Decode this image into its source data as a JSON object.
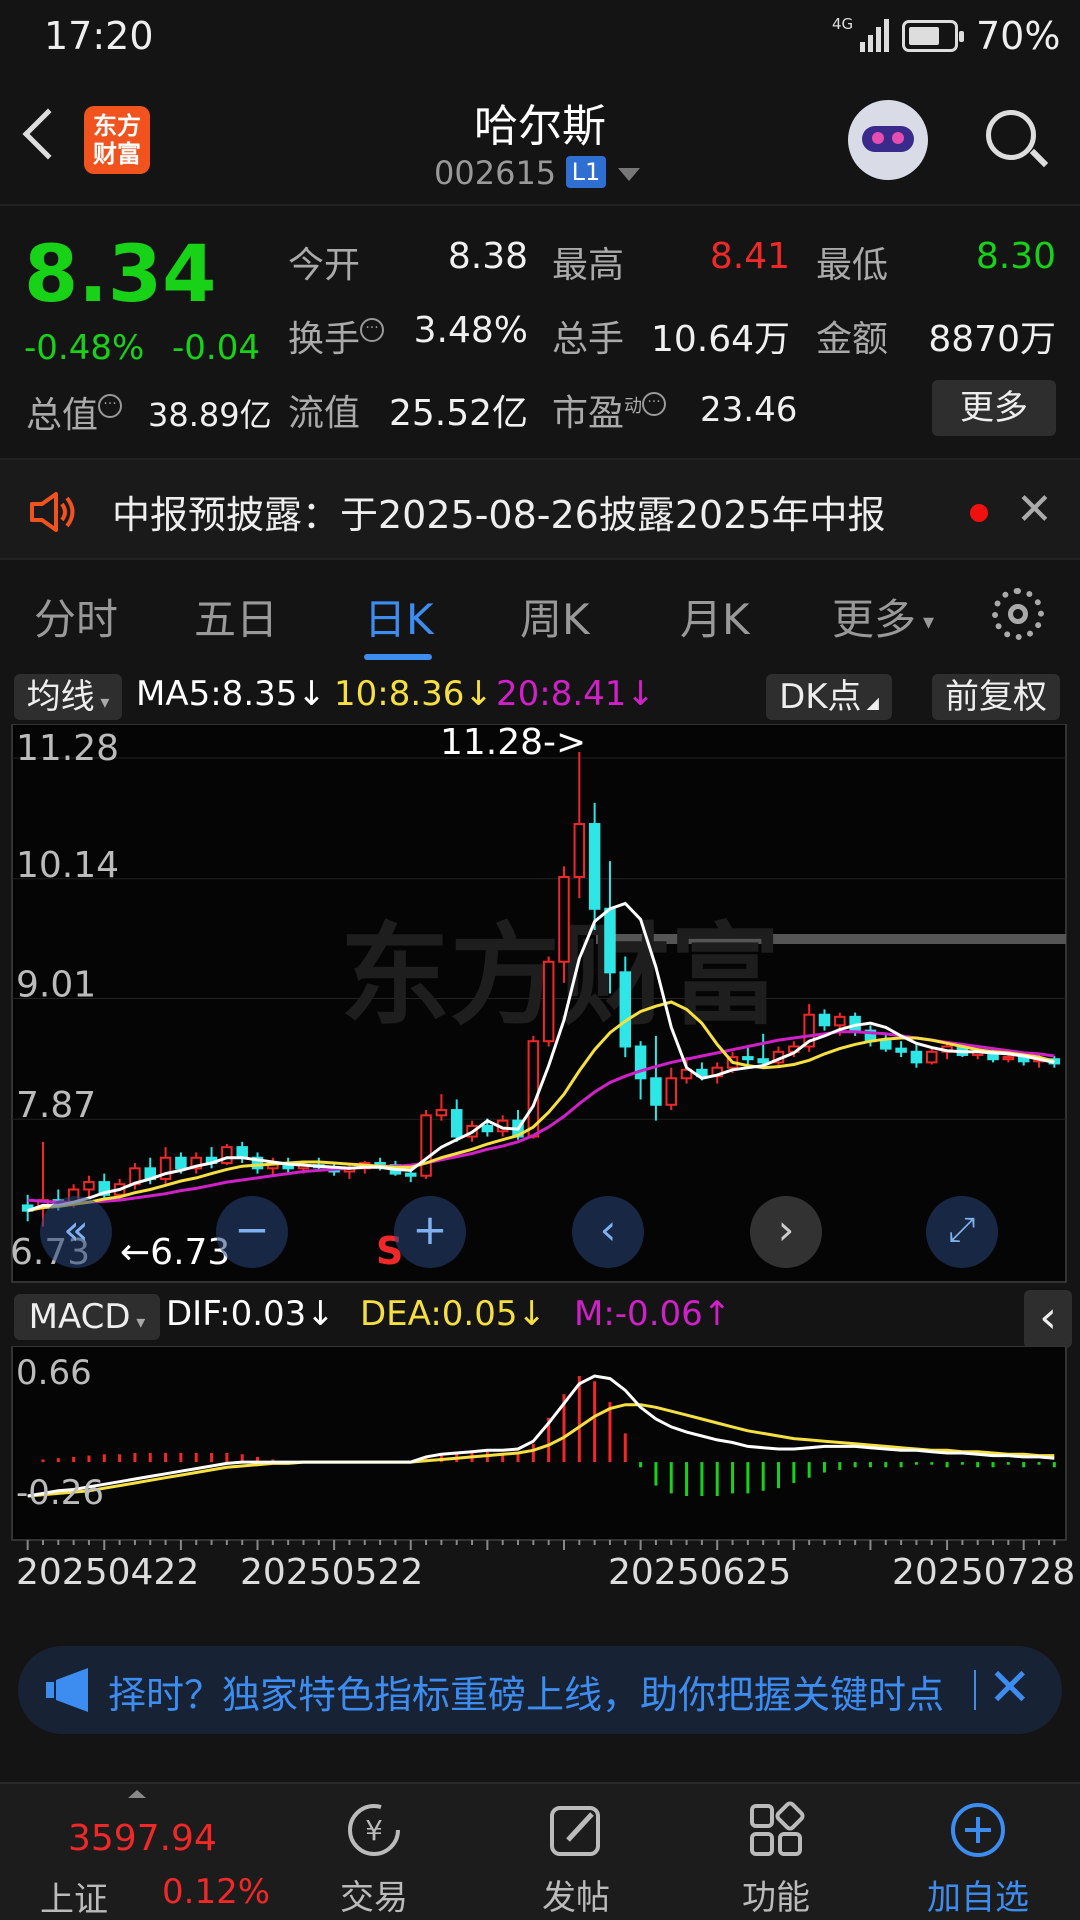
{
  "status_bar": {
    "time": "17:20",
    "network": "4G",
    "battery": "70%"
  },
  "header": {
    "title": "哈尔斯",
    "code": "002615",
    "level": "L1",
    "logo_line1": "东方",
    "logo_line2": "财富"
  },
  "quote": {
    "price": "8.34",
    "change_pct": "-0.48%",
    "change": "-0.04",
    "open_label": "今开",
    "open": "8.38",
    "high_label": "最高",
    "high": "8.41",
    "low_label": "最低",
    "low": "8.30",
    "turnover_label": "换手",
    "turnover": "3.48%",
    "volume_label": "总手",
    "volume": "10.64万",
    "amount_label": "金额",
    "amount": "8870万",
    "mcap_label": "总值",
    "mcap": "38.89亿",
    "float_label": "流值",
    "float": "25.52亿",
    "pe_label": "市盈",
    "pe_sup": "动",
    "pe": "23.46",
    "more_label": "更多"
  },
  "notice": {
    "text": "中报预披露：于2025-08-26披露2025年中报"
  },
  "tabs": [
    "分时",
    "五日",
    "日K",
    "周K",
    "月K",
    "更多"
  ],
  "active_tab": "日K",
  "ma_bar": {
    "select": "均线",
    "ma5": "MA5:8.35↓",
    "ma10": "10:8.36↓",
    "ma20": "20:8.41↓",
    "dk": "DK点",
    "adjust": "前复权"
  },
  "colors": {
    "up": "#f02828",
    "down": "#17d217",
    "candle_down": "#2ee6e6",
    "ma5": "#ffffff",
    "ma10": "#f5e040",
    "ma20": "#d020c8",
    "accent": "#3d8cf0"
  },
  "kline_labels": {
    "max_marker": "11.28->",
    "min_marker": "6.73",
    "min_marker_arrow": "←6.73",
    "signal": "S",
    "watermark": "东方财富"
  },
  "macd_bar": {
    "select": "MACD",
    "dif": "DIF:0.03↓",
    "dea": "DEA:0.05↓",
    "m": "M:-0.06↑"
  },
  "chart_data": [
    {
      "type": "candlestick",
      "yticks": [
        "11.28",
        "10.14",
        "9.01",
        "7.87"
      ],
      "ylim": [
        6.73,
        11.28
      ],
      "max": 11.28,
      "min": 6.73,
      "ohlc": [
        [
          7.0,
          7.1,
          6.85,
          6.95
        ],
        [
          6.98,
          7.6,
          6.8,
          7.05
        ],
        [
          7.05,
          7.15,
          6.95,
          7.0
        ],
        [
          7.02,
          7.2,
          6.98,
          7.15
        ],
        [
          7.15,
          7.28,
          7.08,
          7.22
        ],
        [
          7.22,
          7.3,
          7.05,
          7.1
        ],
        [
          7.1,
          7.25,
          7.05,
          7.2
        ],
        [
          7.2,
          7.4,
          7.15,
          7.35
        ],
        [
          7.35,
          7.45,
          7.2,
          7.25
        ],
        [
          7.25,
          7.55,
          7.2,
          7.45
        ],
        [
          7.45,
          7.5,
          7.3,
          7.35
        ],
        [
          7.35,
          7.5,
          7.3,
          7.45
        ],
        [
          7.45,
          7.55,
          7.35,
          7.4
        ],
        [
          7.4,
          7.58,
          7.38,
          7.55
        ],
        [
          7.55,
          7.6,
          7.4,
          7.45
        ],
        [
          7.45,
          7.5,
          7.3,
          7.35
        ],
        [
          7.35,
          7.45,
          7.28,
          7.4
        ],
        [
          7.4,
          7.45,
          7.3,
          7.35
        ],
        [
          7.35,
          7.42,
          7.3,
          7.38
        ],
        [
          7.38,
          7.45,
          7.32,
          7.36
        ],
        [
          7.36,
          7.4,
          7.28,
          7.32
        ],
        [
          7.32,
          7.38,
          7.25,
          7.35
        ],
        [
          7.35,
          7.42,
          7.3,
          7.4
        ],
        [
          7.4,
          7.45,
          7.33,
          7.38
        ],
        [
          7.38,
          7.42,
          7.28,
          7.3
        ],
        [
          7.3,
          7.36,
          7.22,
          7.28
        ],
        [
          7.28,
          7.9,
          7.25,
          7.85
        ],
        [
          7.85,
          8.05,
          7.8,
          7.9
        ],
        [
          7.9,
          8.0,
          7.6,
          7.65
        ],
        [
          7.65,
          7.8,
          7.6,
          7.75
        ],
        [
          7.75,
          7.82,
          7.65,
          7.7
        ],
        [
          7.7,
          7.85,
          7.65,
          7.8
        ],
        [
          7.8,
          7.9,
          7.62,
          7.65
        ],
        [
          7.65,
          8.6,
          7.63,
          8.55
        ],
        [
          8.55,
          9.35,
          8.5,
          9.3
        ],
        [
          9.3,
          10.2,
          9.1,
          10.1
        ],
        [
          10.1,
          11.28,
          9.9,
          10.6
        ],
        [
          10.6,
          10.8,
          9.6,
          9.8
        ],
        [
          9.8,
          10.25,
          9.0,
          9.2
        ],
        [
          9.2,
          9.35,
          8.4,
          8.5
        ],
        [
          8.5,
          8.55,
          8.0,
          8.2
        ],
        [
          8.2,
          8.6,
          7.8,
          7.95
        ],
        [
          7.95,
          8.3,
          7.9,
          8.2
        ],
        [
          8.2,
          8.4,
          8.15,
          8.28
        ],
        [
          8.28,
          8.35,
          8.18,
          8.22
        ],
        [
          8.22,
          8.35,
          8.15,
          8.3
        ],
        [
          8.3,
          8.45,
          8.25,
          8.4
        ],
        [
          8.4,
          8.5,
          8.32,
          8.38
        ],
        [
          8.38,
          8.62,
          8.3,
          8.35
        ],
        [
          8.35,
          8.5,
          8.3,
          8.45
        ],
        [
          8.45,
          8.55,
          8.4,
          8.5
        ],
        [
          8.5,
          8.9,
          8.45,
          8.8
        ],
        [
          8.8,
          8.85,
          8.65,
          8.7
        ],
        [
          8.7,
          8.82,
          8.6,
          8.78
        ],
        [
          8.78,
          8.82,
          8.6,
          8.65
        ],
        [
          8.65,
          8.7,
          8.5,
          8.55
        ],
        [
          8.55,
          8.62,
          8.45,
          8.48
        ],
        [
          8.48,
          8.55,
          8.4,
          8.45
        ],
        [
          8.45,
          8.52,
          8.3,
          8.35
        ],
        [
          8.35,
          8.5,
          8.33,
          8.45
        ],
        [
          8.45,
          8.55,
          8.38,
          8.5
        ],
        [
          8.5,
          8.52,
          8.4,
          8.42
        ],
        [
          8.42,
          8.5,
          8.38,
          8.45
        ],
        [
          8.45,
          8.48,
          8.35,
          8.38
        ],
        [
          8.38,
          8.45,
          8.35,
          8.4
        ],
        [
          8.4,
          8.45,
          8.32,
          8.36
        ],
        [
          8.36,
          8.42,
          8.3,
          8.38
        ],
        [
          8.38,
          8.41,
          8.3,
          8.34
        ]
      ],
      "ma5": [
        6.95,
        7.0,
        7.0,
        7.03,
        7.07,
        7.12,
        7.15,
        7.21,
        7.25,
        7.3,
        7.33,
        7.37,
        7.4,
        7.45,
        7.45,
        7.43,
        7.41,
        7.39,
        7.38,
        7.37,
        7.36,
        7.35,
        7.36,
        7.36,
        7.34,
        7.33,
        7.44,
        7.55,
        7.62,
        7.69,
        7.8,
        7.73,
        7.72,
        7.94,
        8.32,
        8.75,
        9.33,
        9.68,
        9.8,
        9.85,
        9.7,
        9.25,
        8.68,
        8.3,
        8.2,
        8.23,
        8.28,
        8.3,
        8.32,
        8.38,
        8.44,
        8.55,
        8.6,
        8.66,
        8.7,
        8.72,
        8.68,
        8.6,
        8.53,
        8.49,
        8.46,
        8.45,
        8.45,
        8.44,
        8.43,
        8.41,
        8.38,
        8.35
      ],
      "ma10": [
        6.95,
        6.98,
        6.99,
        7.01,
        7.03,
        7.06,
        7.08,
        7.12,
        7.15,
        7.19,
        7.23,
        7.26,
        7.3,
        7.34,
        7.37,
        7.38,
        7.39,
        7.4,
        7.41,
        7.41,
        7.4,
        7.39,
        7.38,
        7.37,
        7.36,
        7.36,
        7.4,
        7.45,
        7.49,
        7.53,
        7.58,
        7.62,
        7.66,
        7.74,
        7.88,
        8.05,
        8.27,
        8.47,
        8.63,
        8.74,
        8.83,
        8.88,
        8.92,
        8.85,
        8.72,
        8.52,
        8.35,
        8.32,
        8.3,
        8.31,
        8.33,
        8.37,
        8.43,
        8.48,
        8.52,
        8.55,
        8.57,
        8.58,
        8.58,
        8.56,
        8.53,
        8.5,
        8.47,
        8.45,
        8.44,
        8.42,
        8.4,
        8.36
      ],
      "ma20": [
        7.05,
        7.04,
        7.03,
        7.03,
        7.03,
        7.04,
        7.05,
        7.07,
        7.09,
        7.11,
        7.14,
        7.16,
        7.19,
        7.22,
        7.24,
        7.26,
        7.28,
        7.3,
        7.32,
        7.33,
        7.34,
        7.35,
        7.36,
        7.37,
        7.37,
        7.38,
        7.4,
        7.43,
        7.46,
        7.49,
        7.53,
        7.56,
        7.6,
        7.66,
        7.74,
        7.84,
        7.96,
        8.07,
        8.16,
        8.22,
        8.27,
        8.31,
        8.35,
        8.38,
        8.41,
        8.44,
        8.47,
        8.5,
        8.53,
        8.56,
        8.58,
        8.6,
        8.62,
        8.64,
        8.64,
        8.63,
        8.62,
        8.6,
        8.58,
        8.56,
        8.54,
        8.52,
        8.5,
        8.48,
        8.46,
        8.44,
        8.43,
        8.41
      ]
    },
    {
      "type": "macd",
      "yticks": [
        "0.66",
        "-0.26"
      ],
      "ylim": [
        -0.26,
        0.66
      ],
      "dif": [
        -0.26,
        -0.24,
        -0.22,
        -0.21,
        -0.19,
        -0.17,
        -0.15,
        -0.13,
        -0.11,
        -0.09,
        -0.07,
        -0.05,
        -0.03,
        -0.01,
        0.0,
        0.0,
        0.0,
        0.0,
        0.0,
        0.0,
        0.0,
        0.0,
        0.0,
        0.0,
        0.0,
        0.0,
        0.04,
        0.06,
        0.07,
        0.08,
        0.09,
        0.09,
        0.1,
        0.16,
        0.3,
        0.45,
        0.6,
        0.66,
        0.64,
        0.55,
        0.42,
        0.33,
        0.27,
        0.23,
        0.2,
        0.17,
        0.15,
        0.12,
        0.11,
        0.1,
        0.1,
        0.11,
        0.12,
        0.12,
        0.12,
        0.11,
        0.1,
        0.09,
        0.09,
        0.08,
        0.07,
        0.07,
        0.06,
        0.05,
        0.05,
        0.04,
        0.04,
        0.03
      ],
      "dea": [
        -0.26,
        -0.25,
        -0.24,
        -0.23,
        -0.22,
        -0.2,
        -0.18,
        -0.16,
        -0.14,
        -0.12,
        -0.1,
        -0.08,
        -0.06,
        -0.04,
        -0.03,
        -0.02,
        -0.01,
        -0.01,
        0.0,
        0.0,
        0.0,
        0.0,
        0.0,
        0.0,
        0.0,
        0.0,
        0.01,
        0.02,
        0.03,
        0.04,
        0.05,
        0.06,
        0.07,
        0.09,
        0.13,
        0.19,
        0.27,
        0.35,
        0.41,
        0.44,
        0.44,
        0.42,
        0.39,
        0.36,
        0.33,
        0.3,
        0.27,
        0.24,
        0.22,
        0.2,
        0.18,
        0.17,
        0.16,
        0.15,
        0.14,
        0.13,
        0.12,
        0.11,
        0.1,
        0.09,
        0.09,
        0.08,
        0.08,
        0.07,
        0.06,
        0.06,
        0.05,
        0.05
      ],
      "m": [
        0.0,
        0.02,
        0.03,
        0.04,
        0.05,
        0.06,
        0.06,
        0.07,
        0.07,
        0.07,
        0.07,
        0.07,
        0.07,
        0.07,
        0.06,
        0.04,
        0.02,
        0.01,
        0.0,
        0.0,
        0.0,
        0.0,
        0.0,
        0.0,
        0.0,
        0.0,
        0.04,
        0.06,
        0.08,
        0.08,
        0.08,
        0.07,
        0.06,
        0.14,
        0.34,
        0.52,
        0.66,
        0.62,
        0.46,
        0.22,
        -0.04,
        -0.18,
        -0.24,
        -0.26,
        -0.26,
        -0.26,
        -0.24,
        -0.24,
        -0.22,
        -0.2,
        -0.16,
        -0.12,
        -0.08,
        -0.06,
        -0.04,
        -0.04,
        -0.04,
        -0.04,
        -0.02,
        -0.02,
        -0.04,
        -0.02,
        -0.04,
        -0.04,
        -0.02,
        -0.04,
        -0.02,
        -0.04
      ]
    }
  ],
  "x_dates": [
    "20250422",
    "20250522",
    "20250625",
    "20250728"
  ],
  "banner": {
    "text": "择时？独家特色指标重磅上线，助你把握关键时点"
  },
  "bottom_nav": {
    "index_value": "3597.94",
    "index_name": "上证",
    "index_change": "0.12%",
    "items": [
      "交易",
      "发帖",
      "功能",
      "加自选"
    ]
  }
}
